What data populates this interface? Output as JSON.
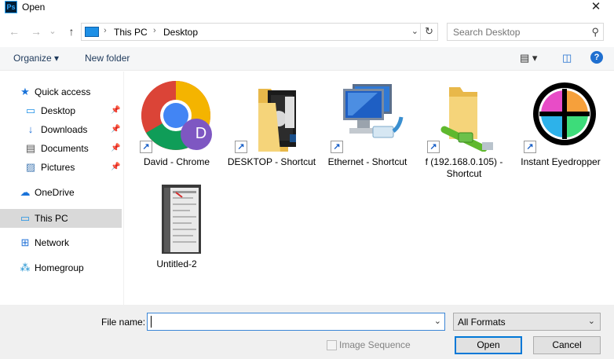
{
  "window": {
    "title": "Open",
    "app_icon": "Ps",
    "close": "✕"
  },
  "nav": {
    "back": "←",
    "forward": "→",
    "recent": "⌄",
    "up": "↑",
    "breadcrumbs": [
      "This PC",
      "Desktop"
    ],
    "separator": "›",
    "dropdown": "⌄",
    "refresh": "↻",
    "search_placeholder": "Search Desktop",
    "search_glyph": "⚲"
  },
  "toolbar": {
    "organize": "Organize ▾",
    "new_folder": "New folder",
    "view_glyph": "▤ ▾",
    "pane_glyph": "◫",
    "help": "?"
  },
  "sidebar": {
    "items": [
      {
        "label": "Quick access",
        "icon": "star-icon",
        "glyph": "★",
        "color": "#1a73d9"
      },
      {
        "label": "Desktop",
        "icon": "desktop-icon",
        "glyph": "▭",
        "color": "#1e90e6",
        "pinned": true
      },
      {
        "label": "Downloads",
        "icon": "download-icon",
        "glyph": "↓",
        "color": "#1e6fd6",
        "pinned": true
      },
      {
        "label": "Documents",
        "icon": "document-icon",
        "glyph": "▤",
        "color": "#555555",
        "pinned": true
      },
      {
        "label": "Pictures",
        "icon": "picture-icon",
        "glyph": "▨",
        "color": "#4a7eb5",
        "pinned": true
      },
      {
        "label": "OneDrive",
        "icon": "cloud-icon",
        "glyph": "☁",
        "color": "#1a73d9"
      },
      {
        "label": "This PC",
        "icon": "computer-icon",
        "glyph": "▭",
        "color": "#1e90e6",
        "selected": true
      },
      {
        "label": "Network",
        "icon": "network-icon",
        "glyph": "⊞",
        "color": "#1e6fd6"
      },
      {
        "label": "Homegroup",
        "icon": "homegroup-icon",
        "glyph": "⁂",
        "color": "#1a8fd0"
      }
    ],
    "pin_glyph": "📌"
  },
  "files": [
    {
      "label": "David - Chrome",
      "icon": "chrome-icon",
      "shortcut": true,
      "avatar_letter": "D"
    },
    {
      "label": "DESKTOP - Shortcut",
      "icon": "folder-icon",
      "shortcut": true
    },
    {
      "label": "Ethernet - Shortcut",
      "icon": "ethernet-icon",
      "shortcut": true
    },
    {
      "label": "f (192.168.0.105) - Shortcut",
      "icon": "network-drive-icon",
      "shortcut": true
    },
    {
      "label": "Instant Eyedropper",
      "icon": "eyedropper-icon",
      "shortcut": true
    },
    {
      "label": "Untitled-2",
      "icon": "document-thumbnail-icon",
      "shortcut": false
    }
  ],
  "shortcut_glyph": "↗",
  "footer": {
    "file_name_label": "File name:",
    "file_name_value": "",
    "format": "All Formats",
    "dropdown": "⌄",
    "image_sequence": "Image Sequence",
    "open": "Open",
    "cancel": "Cancel"
  },
  "colors": {
    "accent": "#0078d7",
    "selected_bg": "#d9d9d9",
    "footer_bg": "#f0f0f0"
  }
}
